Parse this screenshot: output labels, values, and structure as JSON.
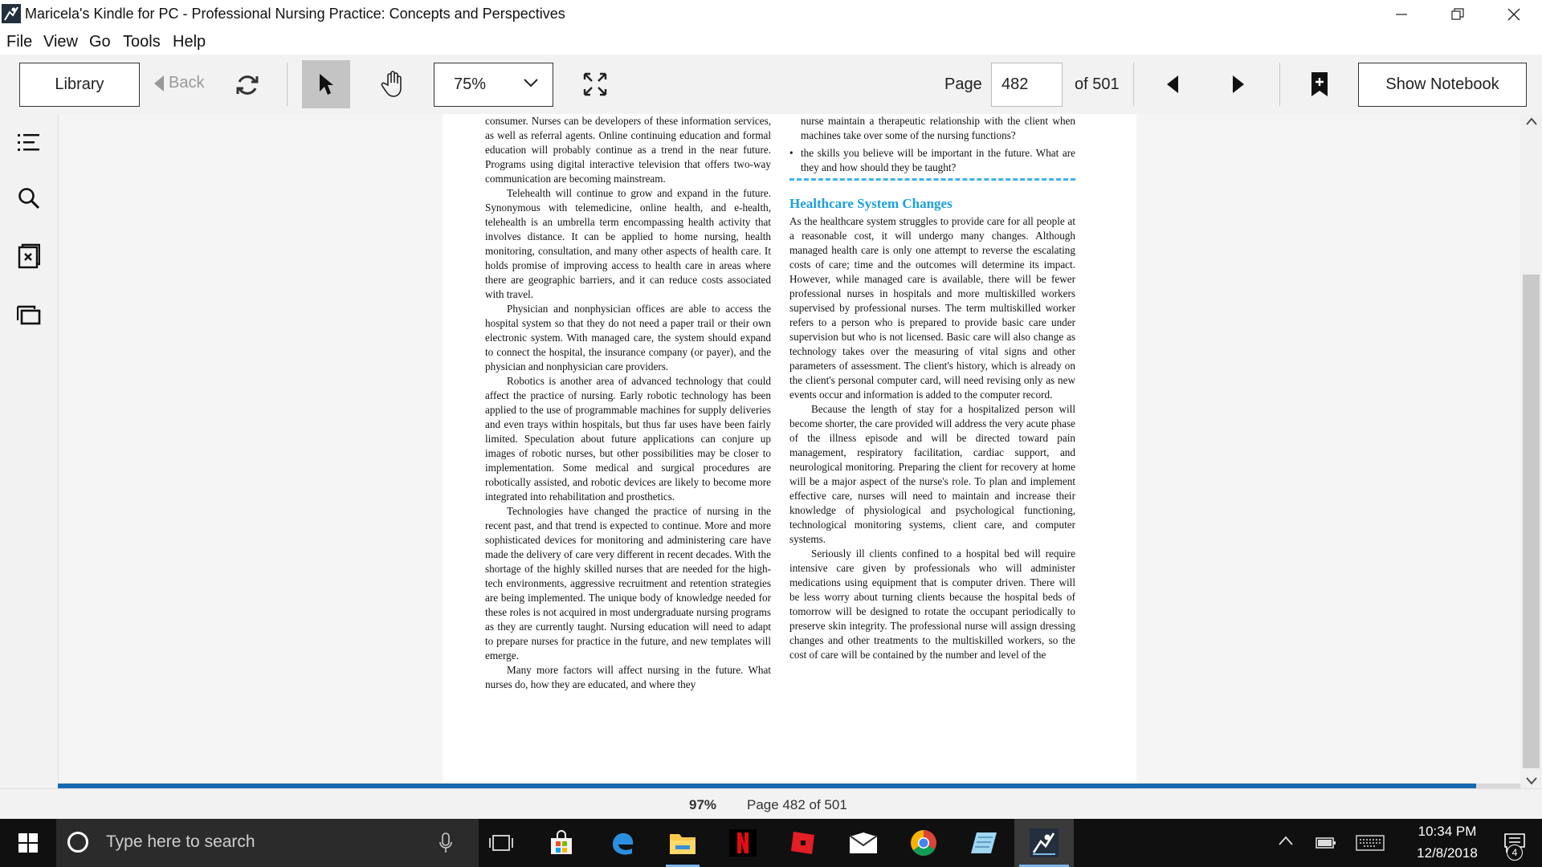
{
  "window": {
    "title": "Maricela's Kindle for PC - Professional Nursing Practice: Concepts and Perspectives"
  },
  "menu": [
    "File",
    "View",
    "Go",
    "Tools",
    "Help"
  ],
  "toolbar": {
    "library_label": "Library",
    "back_label": "Back",
    "zoom_value": "75%",
    "page_label": "Page",
    "page_value": "482",
    "page_of": "of 501",
    "show_notebook_label": "Show Notebook"
  },
  "book": {
    "left_column": [
      "consumer. Nurses can be developers of these information services, as well as referral agents. Online continuing education and formal education will probably continue as a trend in the near future. Programs using digital interactive television that offers two-way communication are becoming mainstream.",
      "Telehealth will continue to grow and expand in the future. Synonymous with telemedicine, online health, and e-health, telehealth is an umbrella term encompassing health activity that involves distance. It can be applied to home nursing, health monitoring, consultation, and many other aspects of health care. It holds promise of improving access to health care in areas where there are geographic barriers, and it can reduce costs associated with travel.",
      "Physician and nonphysician offices are able to access the hospital system so that they do not need a paper trail or their own electronic system. With managed care, the system should expand to connect the hospital, the insurance company (or payer), and the physician and nonphysician care providers.",
      "Robotics is another area of advanced technology that could affect the practice of nursing. Early robotic technology has been applied to the use of programmable machines for supply deliveries and even trays within hospitals, but thus far uses have been fairly limited. Speculation about future applications can conjure up images of robotic nurses, but other possibilities may be closer to implementation. Some medical and surgical procedures are robotically assisted, and robotic devices are likely to become more integrated into rehabilitation and prosthetics.",
      "Technologies have changed the practice of nursing in the recent past, and that trend is expected to continue. More and more sophisticated devices for monitoring and administering care have made the delivery of care very different in recent decades. With the shortage of the highly skilled nurses that are needed for the high-tech environments, aggressive recruitment and retention strategies are being implemented. The unique body of knowledge needed for these roles is not acquired in most undergraduate nursing programs as they are currently taught. Nursing education will need to adapt to prepare nurses for practice in the future, and new templates will emerge.",
      "Many more factors will affect nursing in the future. What nurses do, how they are educated, and where they"
    ],
    "right_top": [
      "nurse maintain a therapeutic relationship with the client when machines take over some of the nursing functions?",
      "the skills you believe will be important in the future. What are they and how should they be taught?"
    ],
    "bullet_char": "•",
    "section_heading": "Healthcare System Changes",
    "right_column": [
      "As the healthcare system struggles to provide care for all people at a reasonable cost, it will undergo many changes. Although managed health care is only one attempt to reverse the escalating costs of care; time and the outcomes will determine its impact. However, while managed care is available, there will be fewer professional nurses in hospitals and more multiskilled workers supervised by professional nurses. The term multiskilled worker refers to a person who is prepared to provide basic care under supervision but who is not licensed. Basic care will also change as technology takes over the measuring of vital signs and other parameters of assessment. The client's history, which is already on the client's personal computer card, will need revising only as new events occur and information is added to the computer record.",
      "Because the length of stay for a hospitalized person will become shorter, the care provided will address the very acute phase of the illness episode and will be directed toward pain management, respiratory facilitation, cardiac support, and neurological monitoring. Preparing the client for recovery at home will be a major aspect of the nurse's role. To plan and implement effective care, nurses will need to maintain and increase their knowledge of physiological and psychological functioning, technological monitoring systems, client care, and computer systems.",
      "Seriously ill clients confined to a hospital bed will require intensive care given by professionals who will administer medications using equipment that is computer driven. There will be less worry about turning clients because the hospital beds of tomorrow will be designed to rotate the occupant periodically to preserve skin integrity. The professional nurse will assign dressing changes and other treatments to the multiskilled workers, so the cost of care will be contained by the number and level of the"
    ]
  },
  "status": {
    "percent": "97%",
    "percent_value": 0.97,
    "page_text": "Page 482 of 501"
  },
  "taskbar": {
    "search_placeholder": "Type here to search",
    "time": "10:34 PM",
    "date": "12/8/2018",
    "notification_count": "4",
    "apps": [
      "task-view-icon",
      "store-icon",
      "edge-icon",
      "file-explorer-icon",
      "netflix-icon",
      "red-app-icon",
      "mail-icon",
      "chrome-icon",
      "notepad-icon",
      "kindle-icon"
    ]
  },
  "colors": {
    "accent_blue": "#1668b0",
    "heading_cyan": "#1aa0dc",
    "taskbar_bg": "#101010"
  }
}
